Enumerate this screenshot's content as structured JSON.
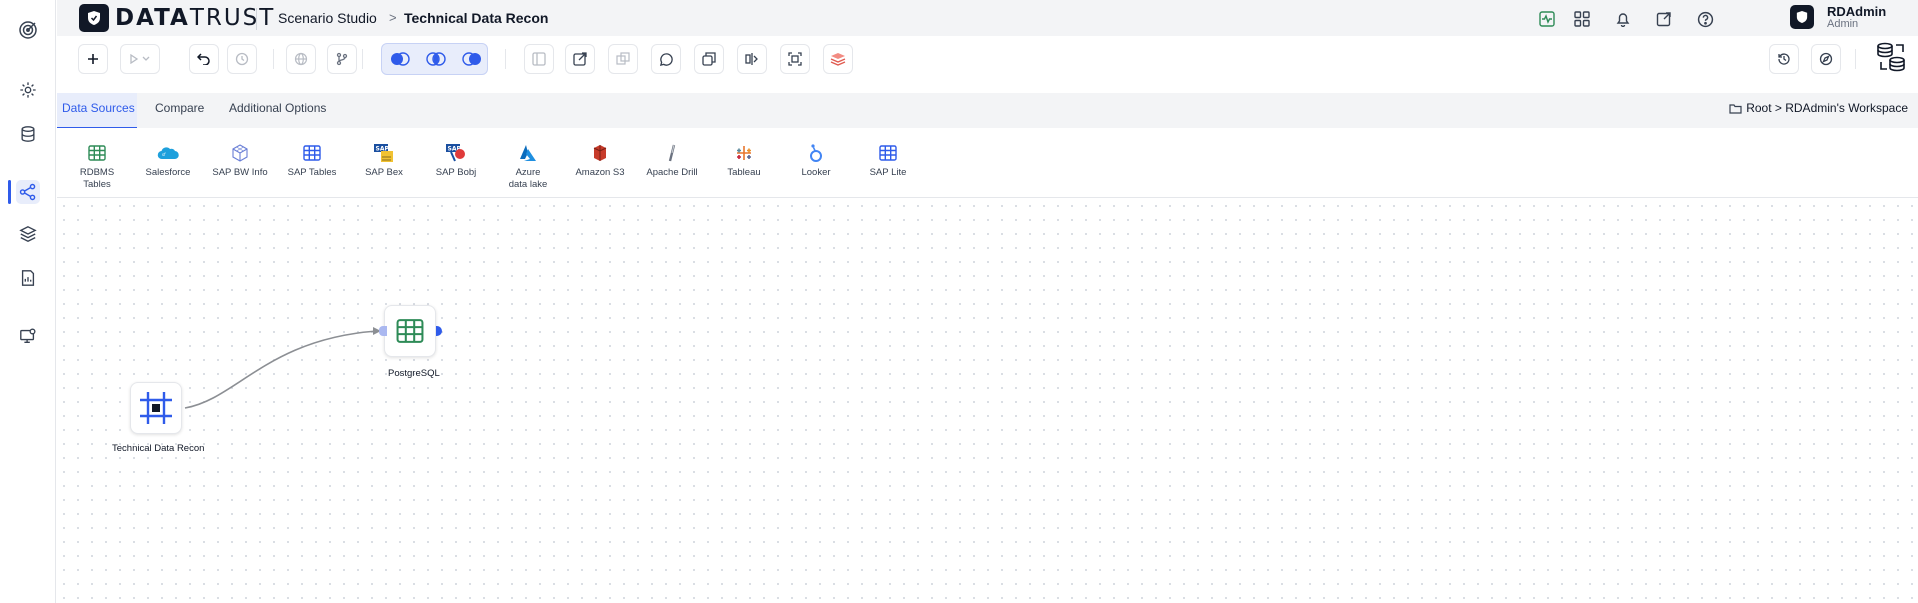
{
  "app": {
    "logo_bold": "DATA",
    "logo_light": "TRUST",
    "breadcrumb_parent": "Scenario Studio",
    "breadcrumb_current": "Technical Data Recon",
    "breadcrumb_arrow": ">"
  },
  "user": {
    "name": "RDAdmin",
    "role": "Admin"
  },
  "tabs": [
    {
      "label": "Data Sources",
      "active": true
    },
    {
      "label": "Compare",
      "active": false
    },
    {
      "label": "Additional Options",
      "active": false
    }
  ],
  "workspace_path": "Root > RDAdmin's Workspace",
  "sources": [
    {
      "label": "RDBMS Tables",
      "icon": "table-icon"
    },
    {
      "label": "Salesforce",
      "icon": "salesforce-cloud-icon"
    },
    {
      "label": "SAP BW Info",
      "icon": "cube-icon"
    },
    {
      "label": "SAP Tables",
      "icon": "table-icon"
    },
    {
      "label": "SAP Bex",
      "icon": "sap-bex-icon"
    },
    {
      "label": "SAP Bobj",
      "icon": "sap-bobj-icon"
    },
    {
      "label": "Azure data lake",
      "icon": "azure-icon"
    },
    {
      "label": "Amazon S3",
      "icon": "amazon-s3-icon"
    },
    {
      "label": "Apache Drill",
      "icon": "apache-drill-icon"
    },
    {
      "label": "Tableau",
      "icon": "tableau-icon"
    },
    {
      "label": "Looker",
      "icon": "looker-icon"
    },
    {
      "label": "SAP Lite",
      "icon": "table-icon"
    }
  ],
  "nodes": {
    "source_label": "Technical Data Recon",
    "target_label": "PostgreSQL"
  },
  "colors": {
    "accent": "#2f5bea",
    "table_green": "#2e8b57",
    "brand_dark": "#111827"
  }
}
